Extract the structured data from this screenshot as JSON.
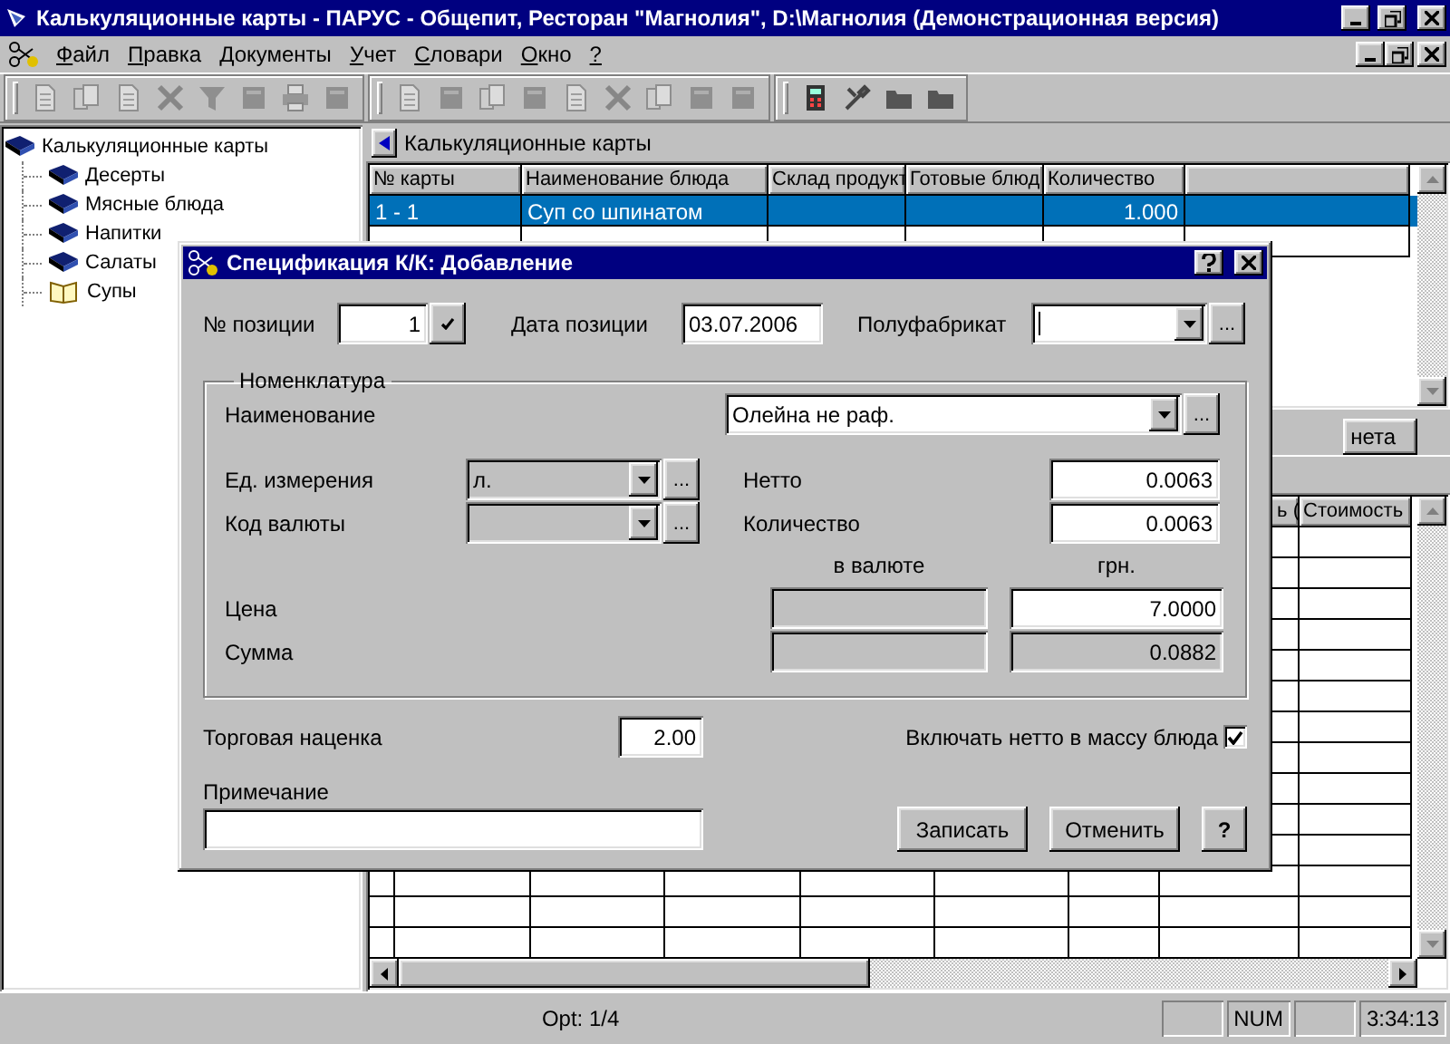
{
  "window": {
    "title": "Калькуляционные карты - ПАРУС - Общепит, Ресторан \"Магнолия\", D:\\Магнолия (Демонстрационная версия)"
  },
  "menu": [
    "Файл",
    "Правка",
    "Документы",
    "Учет",
    "Словари",
    "Окно",
    "?"
  ],
  "tree": {
    "items": [
      {
        "label": "Калькуляционные карты",
        "selected": false,
        "children": [
          {
            "label": "Десерты",
            "selected": false
          },
          {
            "label": "Мясные блюда",
            "selected": false
          },
          {
            "label": "Напитки",
            "selected": false
          },
          {
            "label": "Салаты",
            "selected": false
          },
          {
            "label": "Супы",
            "selected": true
          }
        ]
      }
    ]
  },
  "cards": {
    "title": "Калькуляционные карты",
    "columns": [
      "№ карты",
      "Наименование блюда",
      "Склад продукт",
      "Готовые блюд",
      "Количество"
    ],
    "rows": [
      {
        "card_no": "1 - 1",
        "dish": "Суп со шпинатом",
        "quantity": "1.000",
        "selected": true
      }
    ]
  },
  "details": {
    "tab_label": "нета",
    "columns": [
      "ь (",
      "Стоимость"
    ]
  },
  "dialog": {
    "title": "Спецификация К/К: Добавление",
    "position": {
      "label": "№ позиции",
      "value": "1"
    },
    "date": {
      "label": "Дата позиции",
      "value": "03.07.2006"
    },
    "semi_product": {
      "label": "Полуфабрикат",
      "button": "..."
    },
    "group": {
      "legend": "Номенклатура",
      "name": {
        "label": "Наименование",
        "value": "Олейна не раф.",
        "button": "..."
      },
      "unit": {
        "label": "Ед. измерения",
        "value": "л.",
        "disabled": true,
        "button": "..."
      },
      "currency": {
        "label": "Код валюты",
        "disabled": true,
        "button": "..."
      },
      "net": {
        "label": "Нетто",
        "value": "0.0063"
      },
      "quantity": {
        "label": "Количество",
        "value": "0.0063"
      },
      "col_currency": "в валюте",
      "col_local": "грн.",
      "price": {
        "label": "Цена",
        "value": "7.0000",
        "disabled": false
      },
      "sum": {
        "label": "Сумма",
        "value": "0.0882",
        "disabled": true
      }
    },
    "markup": {
      "label": "Торговая наценка",
      "value": "2.00"
    },
    "include_net": {
      "label": "Включать нетто в массу блюда",
      "checked": true
    },
    "note": {
      "label": "Примечание"
    },
    "buttons": [
      "Записать",
      "Отменить",
      "?"
    ]
  },
  "status_bar": {
    "message": "Opt: 1/4",
    "num": "NUM",
    "time": "3:34:13"
  }
}
